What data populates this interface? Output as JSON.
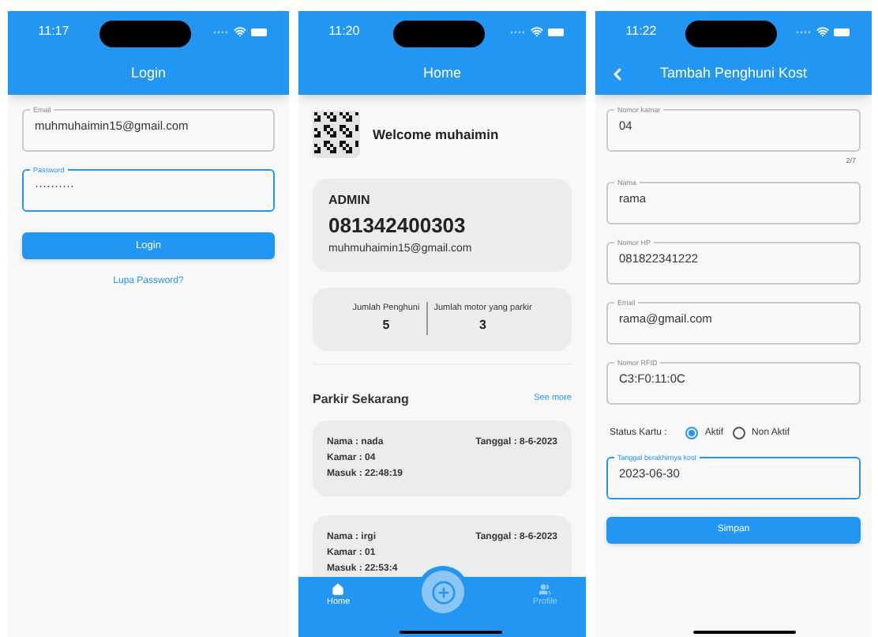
{
  "screens": [
    {
      "kind": "login",
      "status_time": "11:17",
      "title": "Login",
      "fields": [
        {
          "label": "Email",
          "value": "muhmuhaimin15@gmail.com",
          "focused": false
        },
        {
          "label": "Password",
          "value": "··········",
          "focused": true
        }
      ],
      "submit": "Login",
      "link": "Lupa Password?"
    },
    {
      "kind": "home",
      "status_time": "11:20",
      "title": "Home",
      "welcome": "Welcome muhaimin",
      "profile": {
        "role": "ADMIN",
        "phone": "081342400303",
        "email": "muhmuhaimin15@gmail.com"
      },
      "stats": [
        {
          "label": "Jumlah Penghuni",
          "value": "5"
        },
        {
          "label": "Jumlah motor yang parkir",
          "value": "3"
        }
      ],
      "section": {
        "title": "Parkir Sekarang",
        "action": "See more"
      },
      "parking": [
        {
          "name": "Nama : nada",
          "room": "Kamar : 04",
          "time": "Masuk : 22:48:19",
          "date": "Tanggal : 8-6-2023"
        },
        {
          "name": "Nama : irgi",
          "room": "Kamar : 01",
          "time": "Masuk : 22:53:4",
          "date": "Tanggal : 8-6-2023"
        }
      ],
      "nav": [
        {
          "label": "Home",
          "selected": true
        },
        {
          "label": "Profile",
          "selected": false
        }
      ]
    },
    {
      "kind": "form",
      "status_time": "11:22",
      "title": "Tambah Penghuni Kost",
      "back": true,
      "fields": [
        {
          "label": "Nomor kamar",
          "value": "04",
          "focused": false,
          "counter": "2/7"
        },
        {
          "label": "Nama",
          "value": "rama",
          "focused": false
        },
        {
          "label": "Nomor HP",
          "value": "081822341222",
          "focused": false
        },
        {
          "label": "Email",
          "value": "rama@gmail.com",
          "focused": false
        },
        {
          "label": "Nomor RFID",
          "value": "C3:F0:11:0C",
          "focused": false
        }
      ],
      "status": {
        "label": "Status Kartu :",
        "options": [
          {
            "label": "Aktif",
            "selected": true
          },
          {
            "label": "Non Aktif",
            "selected": false
          }
        ]
      },
      "date_field": {
        "label": "Tanggal berakhirnya kost",
        "value": "2023-06-30",
        "focused": true
      },
      "submit": "Simpan"
    }
  ]
}
